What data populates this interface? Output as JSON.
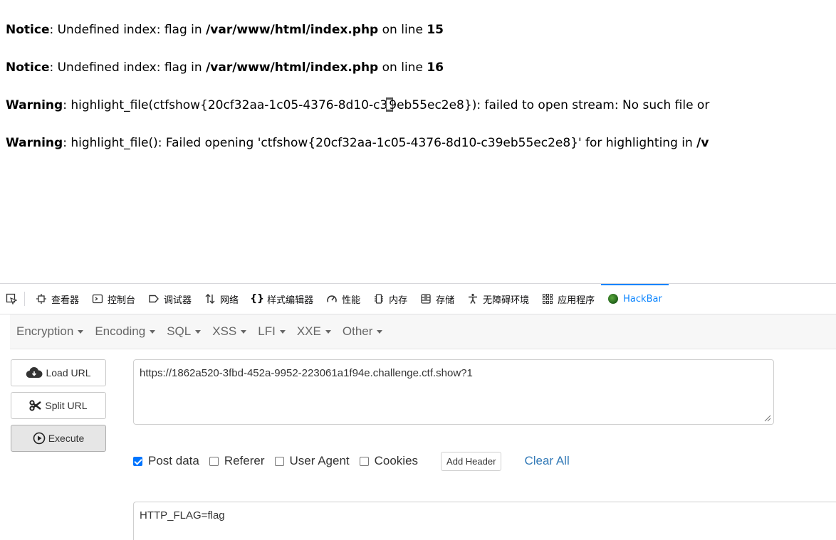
{
  "php_output": [
    {
      "level": "Notice",
      "message": ": Undefined index: flag in ",
      "file": "/var/www/html/index.php",
      "tail": " on line ",
      "line": "15"
    },
    {
      "level": "Notice",
      "message": ": Undefined index: flag in ",
      "file": "/var/www/html/index.php",
      "tail": " on line ",
      "line": "16"
    },
    {
      "level": "Warning",
      "message_a": ": highlight_file(ctfshow{20cf32aa-1c05-4376-8d10-c3",
      "message_b": "9eb55ec2e8}): failed to open stream: No such file or"
    },
    {
      "level": "Warning",
      "message": ": highlight_file(): Failed opening 'ctfshow{20cf32aa-1c05-4376-8d10-c39eb55ec2e8}' for highlighting in ",
      "file": "/v"
    }
  ],
  "devtools": {
    "tabs": [
      {
        "label": "查看器",
        "icon": "inspector-icon"
      },
      {
        "label": "控制台",
        "icon": "console-icon"
      },
      {
        "label": "调试器",
        "icon": "debugger-icon"
      },
      {
        "label": "网络",
        "icon": "network-icon"
      },
      {
        "label": "样式编辑器",
        "icon": "style-editor-icon"
      },
      {
        "label": "性能",
        "icon": "performance-icon"
      },
      {
        "label": "内存",
        "icon": "memory-icon"
      },
      {
        "label": "存储",
        "icon": "storage-icon"
      },
      {
        "label": "无障碍环境",
        "icon": "accessibility-icon"
      },
      {
        "label": "应用程序",
        "icon": "application-icon"
      },
      {
        "label": "HackBar",
        "icon": "hackbar-icon"
      }
    ],
    "active_tab": "HackBar",
    "accent_color": "#0a84ff"
  },
  "hackbar": {
    "menus": [
      "Encryption",
      "Encoding",
      "SQL",
      "XSS",
      "LFI",
      "XXE",
      "Other"
    ],
    "buttons": {
      "load_url": "Load URL",
      "split_url": "Split URL",
      "execute": "Execute"
    },
    "url_value": "https://1862a520-3fbd-452a-9952-223061a1f94e.challenge.ctf.show?1",
    "options": {
      "post_data": {
        "label": "Post data",
        "checked": true
      },
      "referer": {
        "label": "Referer",
        "checked": false
      },
      "user_agent": {
        "label": "User Agent",
        "checked": false
      },
      "cookies": {
        "label": "Cookies",
        "checked": false
      }
    },
    "add_header_label": "Add Header",
    "clear_all_label": "Clear All",
    "post_body": "HTTP_FLAG=flag",
    "link_color": "#337ab7",
    "check_color": "#0075ff"
  }
}
